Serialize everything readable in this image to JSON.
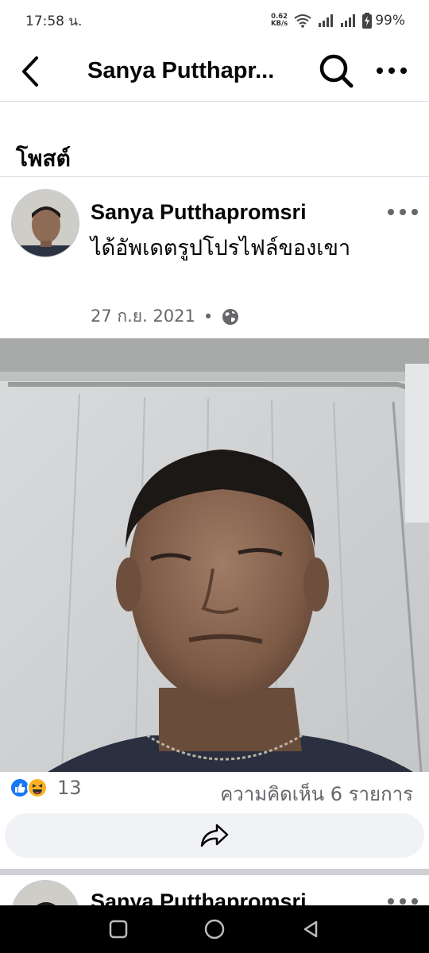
{
  "status_bar": {
    "time": "17:58 น.",
    "net_speed_value": "0.62",
    "net_speed_unit": "KB/s",
    "battery": "99%",
    "icons": [
      "wifi-icon",
      "signal-icon",
      "signal-icon",
      "battery-charging-icon"
    ]
  },
  "header": {
    "title": "Sanya Putthapr...",
    "back_icon": "back-chevron-icon",
    "search_icon": "search-icon",
    "more_icon": "more-horizontal-icon"
  },
  "cut_text": "˙˙ ˙˙ ˙˙˙ ˙˙ ˙ ˙˙˙",
  "section": {
    "title": "โพสต์"
  },
  "post": {
    "author": "Sanya Putthapromsri",
    "action": "ได้อัพเดตรูปโปรไฟล์ของเขา",
    "date": "27 ก.ย. 2021",
    "separator": "•",
    "privacy_icon": "globe-icon",
    "reactions": {
      "icons": [
        "like-icon",
        "haha-icon"
      ],
      "count": "13"
    },
    "comments": "ความคิดเห็น 6 รายการ",
    "share_icon": "share-icon"
  },
  "next_post": {
    "author": "Sanya Putthapromsri"
  },
  "nav_bar": {
    "icons": [
      "recent-apps-icon",
      "home-icon",
      "back-icon"
    ]
  },
  "colors": {
    "facebook_blue": "#1877f2",
    "meta_gray": "#65676b",
    "bar_gray": "#f0f2f5"
  }
}
